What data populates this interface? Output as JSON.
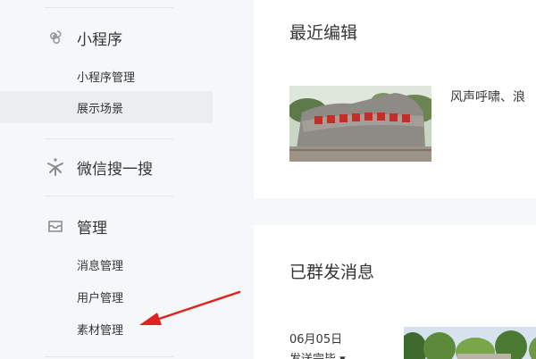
{
  "sidebar": {
    "mini_program": {
      "icon": "mini-program-link-icon",
      "label": "小程序",
      "items": [
        {
          "label": "小程序管理"
        },
        {
          "label": "展示场景",
          "active": true
        }
      ]
    },
    "search": {
      "icon": "wechat-search-star-icon",
      "label": "微信搜一搜"
    },
    "manage": {
      "icon": "inbox-tray-icon",
      "label": "管理",
      "items": [
        {
          "label": "消息管理"
        },
        {
          "label": "用户管理"
        },
        {
          "label": "素材管理"
        }
      ]
    },
    "annotation_arrow_color": "#e02222"
  },
  "main": {
    "recent": {
      "title": "最近编辑",
      "article_text": "风声呼啸、浪",
      "thumbnail": "rock-inscription-photo"
    },
    "sent": {
      "title": "已群发消息",
      "date": "06月05日",
      "status": "发送完毕 ▾",
      "thumbnail": "park-landscape-photo"
    }
  }
}
